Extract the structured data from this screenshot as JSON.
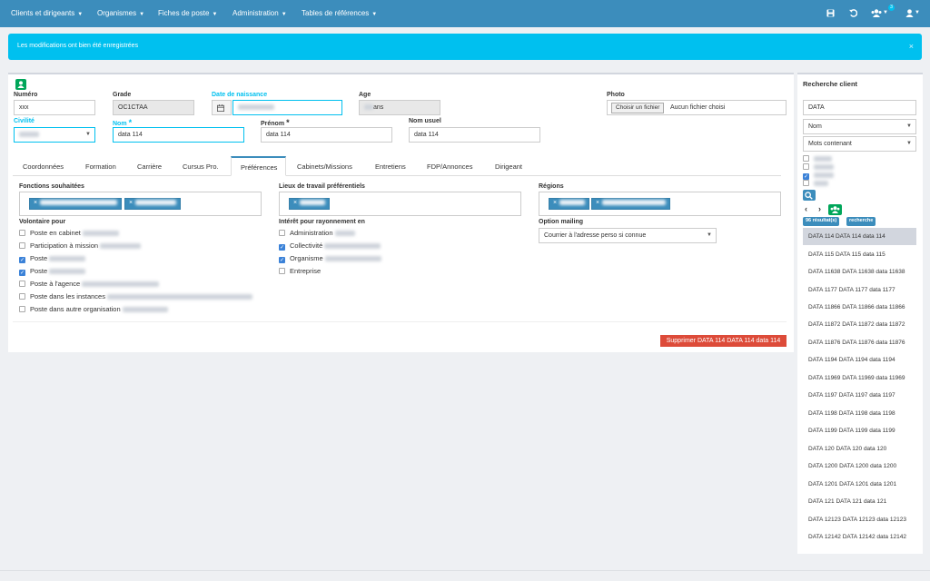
{
  "nav": {
    "items": [
      "Clients et dirigeants",
      "Organismes",
      "Fiches de poste",
      "Administration",
      "Tables de références"
    ],
    "users_badge": "3",
    "icons": [
      "save-icon",
      "undo-icon",
      "users-icon",
      "user-icon"
    ]
  },
  "alert": {
    "text": "Les modifications ont bien été enregistrées",
    "close": "×"
  },
  "form": {
    "numero_label": "Numéro",
    "numero_value": "xxx",
    "grade_label": "Grade",
    "grade_value": "OC1CTAA",
    "naissance_label": "Date de naissance",
    "age_label": "Age",
    "age_suffix": "ans",
    "photo_label": "Photo",
    "photo_button": "Choisir un fichier",
    "photo_status": "Aucun fichier choisi",
    "civilite_label": "Civilité",
    "nom_label": "Nom",
    "nom_value": "data  114",
    "prenom_label": "Prénom",
    "prenom_value": "data  114",
    "nom_usuel_label": "Nom usuel",
    "nom_usuel_value": "data  114",
    "required_mark": "*"
  },
  "tabs": [
    "Coordonnées",
    "Formation",
    "Carrière",
    "Cursus Pro.",
    "Préférences",
    "Cabinets/Missions",
    "Entretiens",
    "FDP/Annonces",
    "Dirigeant"
  ],
  "active_tab": "Préférences",
  "preferences": {
    "fonctions_label": "Fonctions souhaitées",
    "lieux_label": "Lieux de travail préférentiels",
    "regions_label": "Régions",
    "volontaire_label": "Volontaire pour",
    "volontaire_items": [
      {
        "label": "Poste en cabinet",
        "checked": false
      },
      {
        "label": "Participation à mission",
        "checked": false
      },
      {
        "label": "Poste",
        "checked": true
      },
      {
        "label": "Poste",
        "checked": true
      },
      {
        "label": "Poste à l'agence",
        "checked": false
      },
      {
        "label": "Poste dans les instances",
        "checked": false
      },
      {
        "label": "Poste dans autre organisation",
        "checked": false
      }
    ],
    "interet_label": "Intérêt pour rayonnement en",
    "interet_items": [
      {
        "label": "Administration",
        "checked": false
      },
      {
        "label": "Collectivité",
        "checked": true
      },
      {
        "label": "Organisme",
        "checked": true
      },
      {
        "label": "Entreprise",
        "checked": false
      }
    ],
    "mailing_label": "Option mailing",
    "mailing_value": "Courrier à l'adresse perso si connue"
  },
  "delete_button": "Supprimer DATA 114 DATA 114 data 114",
  "sidebar": {
    "title": "Recherche client",
    "search_value": "DATA",
    "field_select": "Nom",
    "mode_select": "Mots contenant",
    "results_badge": "96 résultat(s)",
    "search_badge": "recherche",
    "results": [
      "DATA 114 DATA 114 data 114",
      "DATA 115 DATA 115 data 115",
      "DATA 11638 DATA 11638 data 11638",
      "DATA 1177 DATA 1177 data 1177",
      "DATA 11866 DATA 11866 data 11866",
      "DATA 11872 DATA 11872 data 11872",
      "DATA 11876 DATA 11876 data 11876",
      "DATA 1194 DATA 1194 data 1194",
      "DATA 11969 DATA 11969 data 11969",
      "DATA 1197 DATA 1197 data 1197",
      "DATA 1198 DATA 1198 data 1198",
      "DATA 1199 DATA 1199 data 1199",
      "DATA 120 DATA 120 data 120",
      "DATA 1200 DATA 1200 data 1200",
      "DATA 1201 DATA 1201 data 1201",
      "DATA 121 DATA 121 data 121",
      "DATA 12123 DATA 12123 data 12123",
      "DATA 12142 DATA 12142 data 12142"
    ]
  }
}
